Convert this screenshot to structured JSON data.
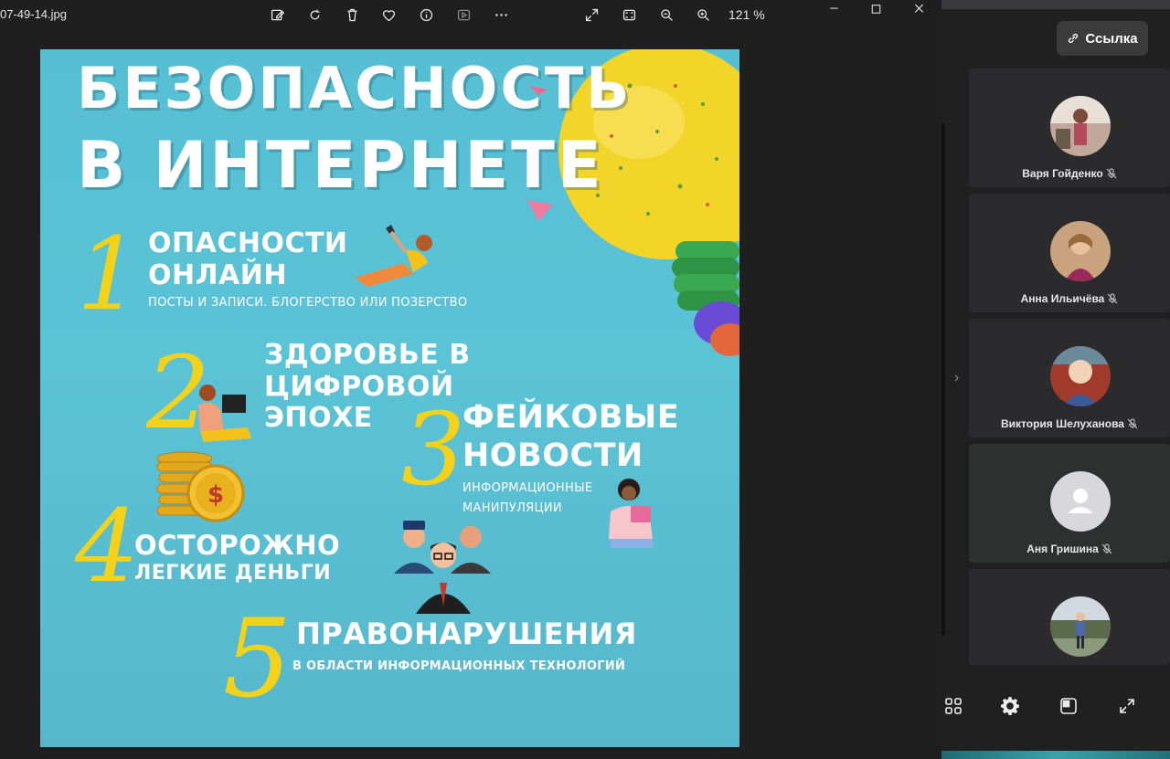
{
  "viewer": {
    "file_name": "07-49-14.jpg",
    "zoom": "121 %",
    "icons": [
      "edit-icon",
      "rotate-icon",
      "delete-icon",
      "favorite-icon",
      "info-icon",
      "slideshow-icon",
      "more-icon",
      "fullscreen-icon",
      "fit-icon",
      "zoom-out-icon",
      "zoom-in-icon",
      "minimize-icon",
      "maximize-icon",
      "close-icon"
    ]
  },
  "slide": {
    "title_line1": "БЕЗОПАСНОСТЬ",
    "title_line2": "В ИНТЕРНЕТЕ",
    "items": [
      {
        "num": "1",
        "head1": "ОПАСНОСТИ",
        "head2": "ОНЛАЙН",
        "sub": "ПОСТЫ И ЗАПИСИ. БЛОГЕРСТВО ИЛИ ПОЗЕРСТВО"
      },
      {
        "num": "2",
        "head1": "ЗДОРОВЬЕ В",
        "head2": "ЦИФРОВОЙ",
        "head3": "ЭПОХЕ"
      },
      {
        "num": "3",
        "head1": "ФЕЙКОВЫЕ",
        "head2": "НОВОСТИ",
        "sub1": "ИНФОРМАЦИОННЫЕ",
        "sub2": "МАНИПУЛЯЦИИ"
      },
      {
        "num": "4",
        "head1": "ОСТОРОЖНО",
        "head2": "ЛЕГКИЕ ДЕНЬГИ"
      },
      {
        "num": "5",
        "head1": "ПРАВОНАРУШЕНИЯ",
        "sub": "В ОБЛАСТИ ИНФОРМАЦИОННЫХ ТЕХНОЛОГИЙ"
      }
    ],
    "colors": {
      "background": "#5bc3d6",
      "accent": "#f5d21a",
      "text": "#ffffff"
    }
  },
  "sidebar": {
    "link_label": "Ссылка",
    "participants": [
      {
        "name": "Варя Гойденко"
      },
      {
        "name": "Анна Ильичёва"
      },
      {
        "name": "Виктория Шелуханова"
      },
      {
        "name": "Аня Гришина"
      },
      {
        "name": ""
      }
    ],
    "controls": [
      "grid-view-icon",
      "settings-icon",
      "layout-icon",
      "expand-icon"
    ]
  }
}
